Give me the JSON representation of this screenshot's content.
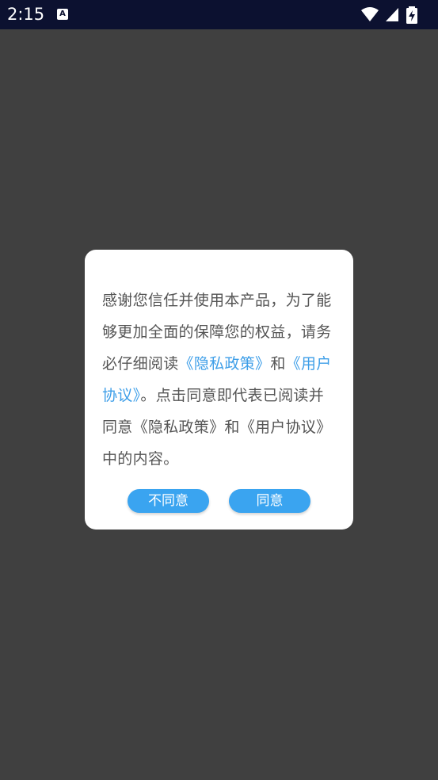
{
  "status_bar": {
    "time": "2:15",
    "app_icon_letter": "A"
  },
  "dialog": {
    "message": {
      "part1": "感谢您信任并使用本产品，为了能够更加全面的保障您的权益，请务必仔细阅读",
      "link_privacy": "《隐私政策》",
      "and1": "和",
      "link_user": "《用户协议》",
      "part2": "。点击同意即代表已阅读并同意《隐私政策》和《用户协议》中的内容。"
    },
    "buttons": {
      "disagree": "不同意",
      "agree": "同意"
    }
  },
  "colors": {
    "accent": "#3aa4f0",
    "link": "#3d9ee8",
    "backdrop": "#404040",
    "status_bar": "#0c1130"
  }
}
